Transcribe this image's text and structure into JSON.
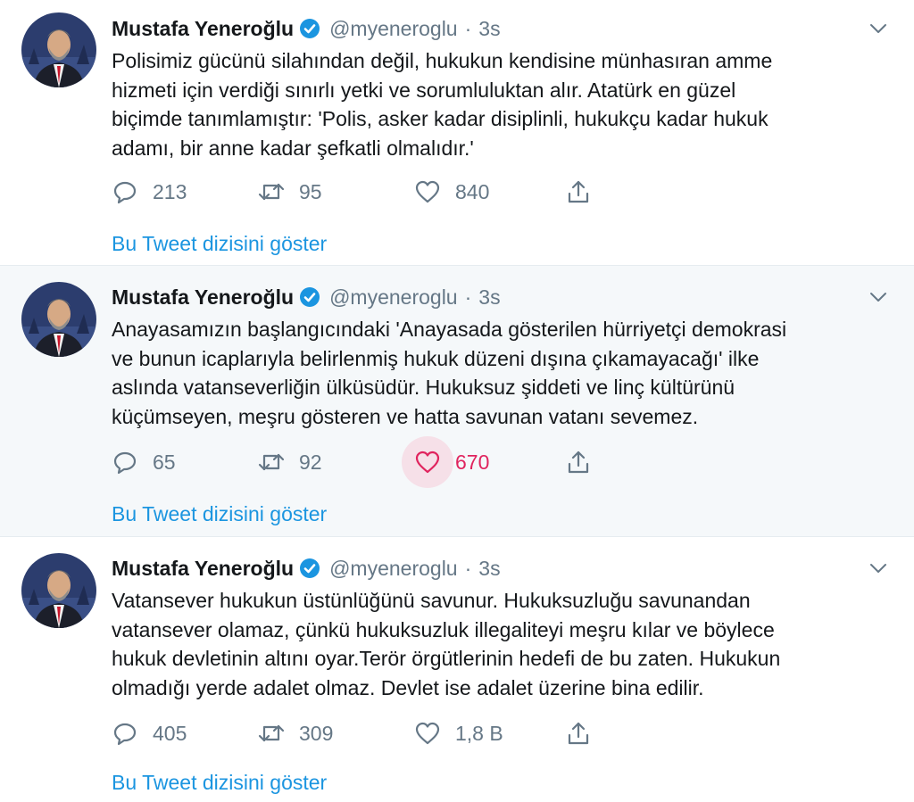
{
  "accent_color": "#1b95e0",
  "like_active_color": "#e0245e",
  "tweets": [
    {
      "author_name": "Mustafa Yeneroğlu",
      "verified_icon": "verified-badge-icon",
      "handle": "@myeneroglu",
      "separator": "·",
      "time": "3s",
      "text_lines": [
        "Polisimiz gücünü silahından değil, hukukun kendisine münhasıran amme",
        "hizmeti için verdiği sınırlı yetki ve sorumluluktan alır. Atatürk en güzel",
        "biçimde tanımlamıştır: 'Polis, asker kadar disiplinli, hukukçu kadar hukuk",
        "adamı, bir anne kadar şefkatli olmalıdır.'"
      ],
      "replies": "213",
      "retweets": "95",
      "likes": "840",
      "liked": false,
      "thread_link": "Bu Tweet dizisini göster"
    },
    {
      "author_name": "Mustafa Yeneroğlu",
      "verified_icon": "verified-badge-icon",
      "handle": "@myeneroglu",
      "separator": "·",
      "time": "3s",
      "text_lines": [
        "Anayasamızın başlangıcındaki 'Anayasada gösterilen hürriyetçi demokrasi",
        "ve bunun icaplarıyla belirlenmiş hukuk düzeni dışına çıkamayacağı' ilke",
        "aslında vatanseverliğin ülküsüdür. Hukuksuz şiddeti ve linç kültürünü",
        "küçümseyen, meşru gösteren ve hatta savunan vatanı sevemez."
      ],
      "replies": "65",
      "retweets": "92",
      "likes": "670",
      "liked": true,
      "thread_link": "Bu Tweet dizisini göster"
    },
    {
      "author_name": "Mustafa Yeneroğlu",
      "verified_icon": "verified-badge-icon",
      "handle": "@myeneroglu",
      "separator": "·",
      "time": "3s",
      "text_lines": [
        "Vatansever hukukun üstünlüğünü savunur. Hukuksuzluğu savunandan",
        "vatansever olamaz, çünkü hukuksuzluk illegaliteyi meşru kılar ve böylece",
        "hukuk devletinin altını oyar.Terör örgütlerinin hedefi de bu zaten. Hukukun",
        "olmadığı yerde adalet olmaz. Devlet ise adalet üzerine bina edilir."
      ],
      "replies": "405",
      "retweets": "309",
      "likes": "1,8 B",
      "liked": false,
      "thread_link": "Bu Tweet dizisini göster"
    }
  ]
}
